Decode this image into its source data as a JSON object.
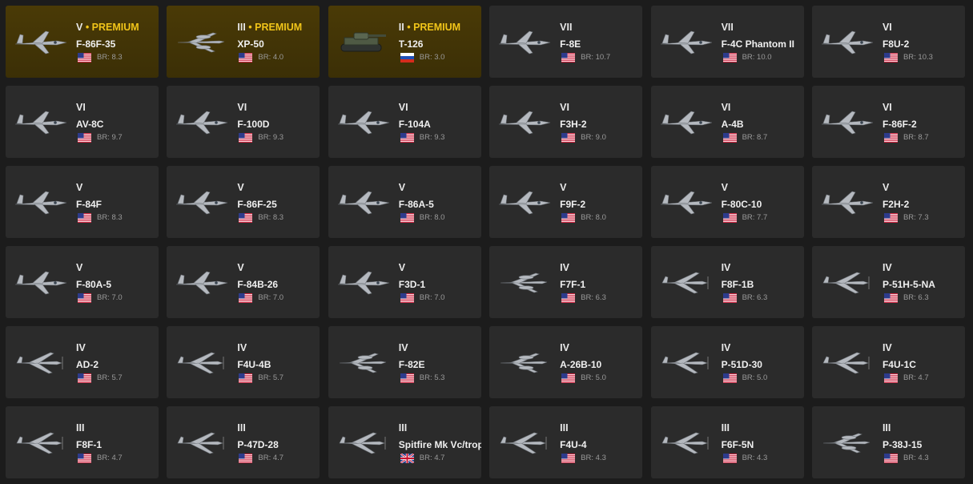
{
  "vehicles": [
    {
      "rank": "V",
      "premium": true,
      "name": "F-86F-35",
      "nation": "usa",
      "br": "BR: 8.3",
      "type": "jet"
    },
    {
      "rank": "III",
      "premium": true,
      "name": "XP-50",
      "nation": "usa",
      "br": "BR: 4.0",
      "type": "twin"
    },
    {
      "rank": "II",
      "premium": true,
      "name": "T-126",
      "nation": "ussr",
      "br": "BR: 3.0",
      "type": "tank"
    },
    {
      "rank": "VII",
      "premium": false,
      "name": "F-8E",
      "nation": "usa",
      "br": "BR: 10.7",
      "type": "jet"
    },
    {
      "rank": "VII",
      "premium": false,
      "name": "F-4C Phantom II",
      "nation": "usa",
      "br": "BR: 10.0",
      "type": "jet"
    },
    {
      "rank": "VI",
      "premium": false,
      "name": "F8U-2",
      "nation": "usa",
      "br": "BR: 10.3",
      "type": "jet"
    },
    {
      "rank": "VI",
      "premium": false,
      "name": "AV-8C",
      "nation": "usa",
      "br": "BR: 9.7",
      "type": "jet"
    },
    {
      "rank": "VI",
      "premium": false,
      "name": "F-100D",
      "nation": "usa",
      "br": "BR: 9.3",
      "type": "jet"
    },
    {
      "rank": "VI",
      "premium": false,
      "name": "F-104A",
      "nation": "usa",
      "br": "BR: 9.3",
      "type": "jet"
    },
    {
      "rank": "VI",
      "premium": false,
      "name": "F3H-2",
      "nation": "usa",
      "br": "BR: 9.0",
      "type": "jet"
    },
    {
      "rank": "VI",
      "premium": false,
      "name": "A-4B",
      "nation": "usa",
      "br": "BR: 8.7",
      "type": "jet"
    },
    {
      "rank": "VI",
      "premium": false,
      "name": "F-86F-2",
      "nation": "usa",
      "br": "BR: 8.7",
      "type": "jet"
    },
    {
      "rank": "V",
      "premium": false,
      "name": "F-84F",
      "nation": "usa",
      "br": "BR: 8.3",
      "type": "jet"
    },
    {
      "rank": "V",
      "premium": false,
      "name": "F-86F-25",
      "nation": "usa",
      "br": "BR: 8.3",
      "type": "jet"
    },
    {
      "rank": "V",
      "premium": false,
      "name": "F-86A-5",
      "nation": "usa",
      "br": "BR: 8.0",
      "type": "jet"
    },
    {
      "rank": "V",
      "premium": false,
      "name": "F9F-2",
      "nation": "usa",
      "br": "BR: 8.0",
      "type": "jet"
    },
    {
      "rank": "V",
      "premium": false,
      "name": "F-80C-10",
      "nation": "usa",
      "br": "BR: 7.7",
      "type": "jet"
    },
    {
      "rank": "V",
      "premium": false,
      "name": "F2H-2",
      "nation": "usa",
      "br": "BR: 7.3",
      "type": "jet"
    },
    {
      "rank": "V",
      "premium": false,
      "name": "F-80A-5",
      "nation": "usa",
      "br": "BR: 7.0",
      "type": "jet"
    },
    {
      "rank": "V",
      "premium": false,
      "name": "F-84B-26",
      "nation": "usa",
      "br": "BR: 7.0",
      "type": "jet"
    },
    {
      "rank": "V",
      "premium": false,
      "name": "F3D-1",
      "nation": "usa",
      "br": "BR: 7.0",
      "type": "jet"
    },
    {
      "rank": "IV",
      "premium": false,
      "name": "F7F-1",
      "nation": "usa",
      "br": "BR: 6.3",
      "type": "twin"
    },
    {
      "rank": "IV",
      "premium": false,
      "name": "F8F-1B",
      "nation": "usa",
      "br": "BR: 6.3",
      "type": "prop"
    },
    {
      "rank": "IV",
      "premium": false,
      "name": "P-51H-5-NA",
      "nation": "usa",
      "br": "BR: 6.3",
      "type": "prop"
    },
    {
      "rank": "IV",
      "premium": false,
      "name": "AD-2",
      "nation": "usa",
      "br": "BR: 5.7",
      "type": "prop"
    },
    {
      "rank": "IV",
      "premium": false,
      "name": "F4U-4B",
      "nation": "usa",
      "br": "BR: 5.7",
      "type": "prop"
    },
    {
      "rank": "IV",
      "premium": false,
      "name": "F-82E",
      "nation": "usa",
      "br": "BR: 5.3",
      "type": "twin"
    },
    {
      "rank": "IV",
      "premium": false,
      "name": "A-26B-10",
      "nation": "usa",
      "br": "BR: 5.0",
      "type": "twin"
    },
    {
      "rank": "IV",
      "premium": false,
      "name": "P-51D-30",
      "nation": "usa",
      "br": "BR: 5.0",
      "type": "prop"
    },
    {
      "rank": "IV",
      "premium": false,
      "name": "F4U-1C",
      "nation": "usa",
      "br": "BR: 4.7",
      "type": "prop"
    },
    {
      "rank": "III",
      "premium": false,
      "name": "F8F-1",
      "nation": "usa",
      "br": "BR: 4.7",
      "type": "prop"
    },
    {
      "rank": "III",
      "premium": false,
      "name": "P-47D-28",
      "nation": "usa",
      "br": "BR: 4.7",
      "type": "prop"
    },
    {
      "rank": "III",
      "premium": false,
      "name": "Spitfire Mk Vc/trop",
      "nation": "uk",
      "br": "BR: 4.7",
      "type": "prop"
    },
    {
      "rank": "III",
      "premium": false,
      "name": "F4U-4",
      "nation": "usa",
      "br": "BR: 4.3",
      "type": "prop"
    },
    {
      "rank": "III",
      "premium": false,
      "name": "F6F-5N",
      "nation": "usa",
      "br": "BR: 4.3",
      "type": "prop"
    },
    {
      "rank": "III",
      "premium": false,
      "name": "P-38J-15",
      "nation": "usa",
      "br": "BR: 4.3",
      "type": "twin"
    }
  ],
  "premium_label": "PREMIUM",
  "premium_separator": " • ",
  "colors": {
    "background": "#1c1c1c",
    "card": "#2b2b2b",
    "premium_card": "#3f3206",
    "premium_text": "#f0c419",
    "br_text": "#9a9a9a"
  }
}
